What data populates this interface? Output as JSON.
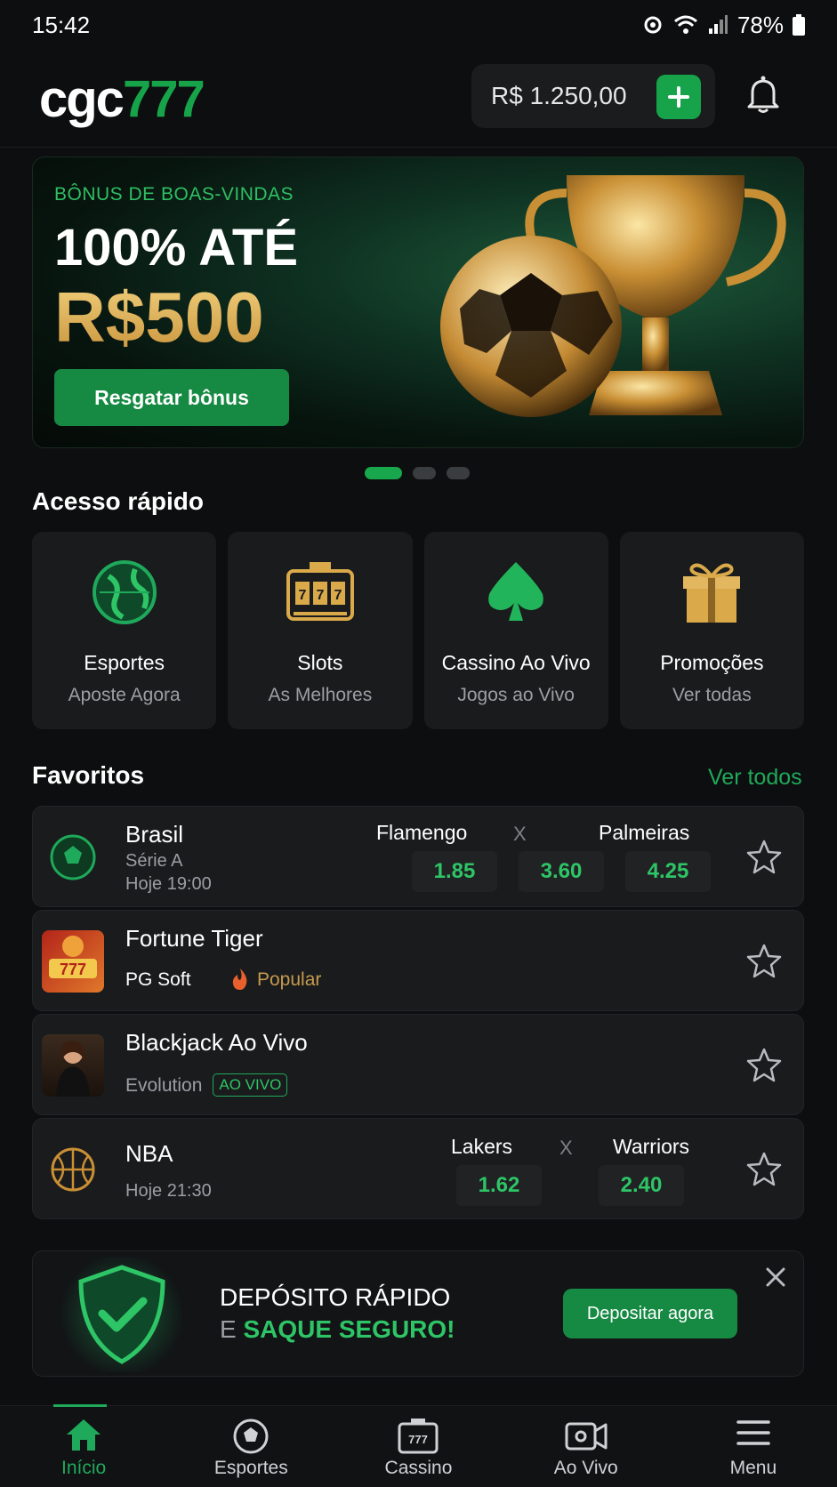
{
  "status_bar": {
    "time": "15:42",
    "battery": "78%"
  },
  "header": {
    "logo_part1": "cgc",
    "logo_part2": "777",
    "balance": "R$ 1.250,00"
  },
  "banner": {
    "kicker": "BÔNUS DE BOAS-VINDAS",
    "line1": "100% ATÉ",
    "line2": "R$500",
    "button": "Resgatar bônus",
    "active_slide": 1,
    "total_slides": 3
  },
  "quick_access": {
    "title": "Acesso rápido",
    "cards": [
      {
        "title": "Esportes",
        "subtitle": "Aposte Agora",
        "icon": "globe-icon"
      },
      {
        "title": "Slots",
        "subtitle": "As Melhores",
        "icon": "slot-machine-icon"
      },
      {
        "title": "Cassino Ao Vivo",
        "subtitle": "Jogos ao Vivo",
        "icon": "spade-icon"
      },
      {
        "title": "Promoções",
        "subtitle": "Ver todas",
        "icon": "gift-icon"
      }
    ]
  },
  "favorites": {
    "title": "Favoritos",
    "see_all": "Ver todos",
    "items": [
      {
        "name": "Brasil",
        "sub1": "Série A",
        "sub2": "Hoje 19:00",
        "home": "Flamengo",
        "vs": "X",
        "away": "Palmeiras",
        "odds": [
          "1.85",
          "3.60",
          "4.25"
        ]
      },
      {
        "name": "Fortune Tiger",
        "provider": "PG Soft",
        "tag": "Popular"
      },
      {
        "name": "Blackjack Ao Vivo",
        "provider": "Evolution",
        "tag": "AO VIVO"
      },
      {
        "name": "NBA",
        "sub2": "Hoje 21:30",
        "home": "Lakers",
        "vs": "X",
        "away": "Warriors",
        "odds": [
          "1.62",
          "2.40"
        ]
      }
    ]
  },
  "promo": {
    "line1": "DEPÓSITO RÁPIDO",
    "line2_prefix": "E",
    "line2_highlight": "SAQUE SEGURO!",
    "button": "Depositar agora"
  },
  "bottom_nav": [
    {
      "label": "Início",
      "active": true
    },
    {
      "label": "Esportes"
    },
    {
      "label": "Cassino"
    },
    {
      "label": "Ao Vivo"
    },
    {
      "label": "Menu"
    }
  ],
  "colors": {
    "accent": "#16a34a",
    "gold": "#d9a94a",
    "background": "#0d0e0f",
    "card": "#1a1b1d"
  }
}
